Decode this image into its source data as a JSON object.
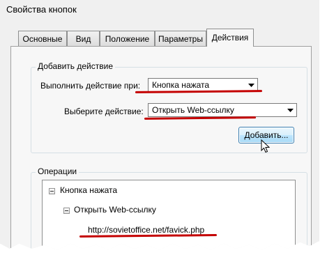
{
  "window": {
    "title": "Свойства кнопок"
  },
  "tabs": [
    {
      "label": "Основные",
      "active": false
    },
    {
      "label": "Вид",
      "active": false
    },
    {
      "label": "Положение",
      "active": false
    },
    {
      "label": "Параметры",
      "active": false
    },
    {
      "label": "Действия",
      "active": true
    }
  ],
  "add_action": {
    "legend": "Добавить действие",
    "trigger_label": "Выполнить действие при:",
    "trigger_value": "Кнопка нажата",
    "action_label": "Выберите действие:",
    "action_value": "Открыть Web-ссылку",
    "add_button": "Добавить..."
  },
  "operations": {
    "legend": "Операции",
    "tree": {
      "root": "Кнопка нажата",
      "child": "Открыть Web-ссылку",
      "leaf": "http://sovietoffice.net/favick.php"
    }
  },
  "icons": {
    "dropdown": "chevron-down-icon",
    "expander": "minus-box-icon",
    "cursor": "mouse-pointer-icon"
  },
  "colors": {
    "annotation_underline": "#c40000",
    "button_border": "#3c7fb1",
    "window_background": "#f0f0f0"
  }
}
